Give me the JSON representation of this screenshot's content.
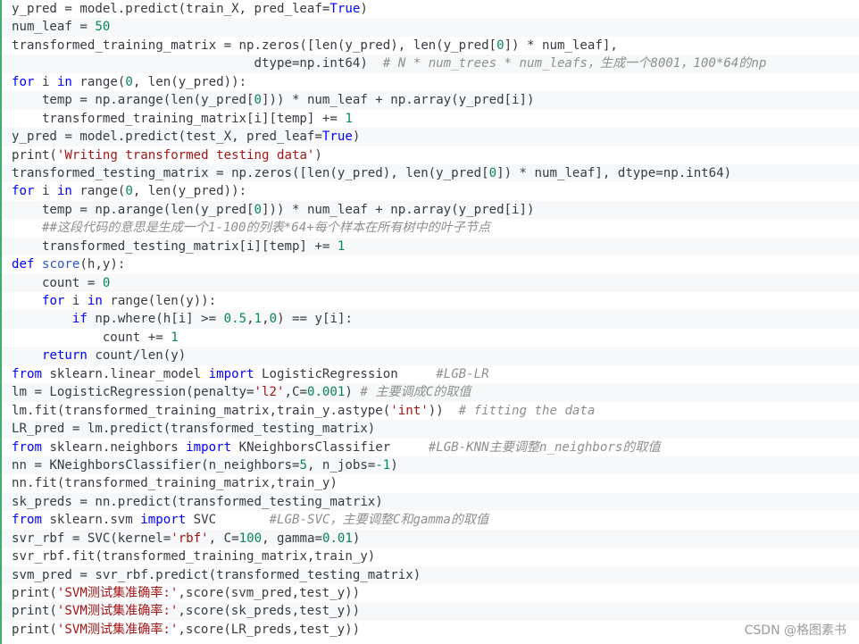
{
  "code": {
    "language": "python",
    "lines": [
      [
        {
          "t": "y_pred = model.predict(train_X, pred_leaf=",
          "c": "p"
        },
        {
          "t": "True",
          "c": "kw"
        },
        {
          "t": ")",
          "c": "p"
        }
      ],
      [
        {
          "t": "num_leaf = ",
          "c": "p"
        },
        {
          "t": "50",
          "c": "num"
        }
      ],
      [
        {
          "t": "transformed_training_matrix = np.zeros([len(y_pred), len(y_pred[",
          "c": "p"
        },
        {
          "t": "0",
          "c": "num"
        },
        {
          "t": "]) * num_leaf],",
          "c": "p"
        }
      ],
      [
        {
          "t": "                                dtype=np.int64)  ",
          "c": "p"
        },
        {
          "t": "# N * num_trees * num_leafs，生成一个8001，100*64的np",
          "c": "cm"
        }
      ],
      [
        {
          "t": "for",
          "c": "kw"
        },
        {
          "t": " i ",
          "c": "p"
        },
        {
          "t": "in",
          "c": "kw"
        },
        {
          "t": " range(",
          "c": "p"
        },
        {
          "t": "0",
          "c": "num"
        },
        {
          "t": ", len(y_pred)):",
          "c": "p"
        }
      ],
      [
        {
          "t": "    temp = np.arange(len(y_pred[",
          "c": "p"
        },
        {
          "t": "0",
          "c": "num"
        },
        {
          "t": "])) * num_leaf + np.array(y_pred[i])",
          "c": "p"
        }
      ],
      [
        {
          "t": "    transformed_training_matrix[i][temp] += ",
          "c": "p"
        },
        {
          "t": "1",
          "c": "num"
        }
      ],
      [
        {
          "t": "y_pred = model.predict(test_X, pred_leaf=",
          "c": "p"
        },
        {
          "t": "True",
          "c": "kw"
        },
        {
          "t": ")",
          "c": "p"
        }
      ],
      [
        {
          "t": "print(",
          "c": "p"
        },
        {
          "t": "'Writing transformed testing data'",
          "c": "str"
        },
        {
          "t": ")",
          "c": "p"
        }
      ],
      [
        {
          "t": "transformed_testing_matrix = np.zeros([len(y_pred), len(y_pred[",
          "c": "p"
        },
        {
          "t": "0",
          "c": "num"
        },
        {
          "t": "]) * num_leaf], dtype=np.int64)",
          "c": "p"
        }
      ],
      [
        {
          "t": "for",
          "c": "kw"
        },
        {
          "t": " i ",
          "c": "p"
        },
        {
          "t": "in",
          "c": "kw"
        },
        {
          "t": " range(",
          "c": "p"
        },
        {
          "t": "0",
          "c": "num"
        },
        {
          "t": ", len(y_pred)):",
          "c": "p"
        }
      ],
      [
        {
          "t": "    temp = np.arange(len(y_pred[",
          "c": "p"
        },
        {
          "t": "0",
          "c": "num"
        },
        {
          "t": "])) * num_leaf + np.array(y_pred[i])",
          "c": "p"
        }
      ],
      [
        {
          "t": "    ",
          "c": "p"
        },
        {
          "t": "##这段代码的意思是生成一个1-100的列表*64+每个样本在所有树中的叶子节点",
          "c": "cm"
        }
      ],
      [
        {
          "t": "    transformed_testing_matrix[i][temp] += ",
          "c": "p"
        },
        {
          "t": "1",
          "c": "num"
        }
      ],
      [
        {
          "t": "def",
          "c": "kw"
        },
        {
          "t": " ",
          "c": "p"
        },
        {
          "t": "score",
          "c": "fn"
        },
        {
          "t": "(h,y):",
          "c": "p"
        }
      ],
      [
        {
          "t": "    count = ",
          "c": "p"
        },
        {
          "t": "0",
          "c": "num"
        }
      ],
      [
        {
          "t": "    ",
          "c": "p"
        },
        {
          "t": "for",
          "c": "kw"
        },
        {
          "t": " i ",
          "c": "p"
        },
        {
          "t": "in",
          "c": "kw"
        },
        {
          "t": " range(len(y)):",
          "c": "p"
        }
      ],
      [
        {
          "t": "        ",
          "c": "p"
        },
        {
          "t": "if",
          "c": "kw"
        },
        {
          "t": " np.where(h[i] >= ",
          "c": "p"
        },
        {
          "t": "0.5",
          "c": "num"
        },
        {
          "t": ",",
          "c": "p"
        },
        {
          "t": "1",
          "c": "num"
        },
        {
          "t": ",",
          "c": "p"
        },
        {
          "t": "0",
          "c": "num"
        },
        {
          "t": ") == y[i]:",
          "c": "p"
        }
      ],
      [
        {
          "t": "            count += ",
          "c": "p"
        },
        {
          "t": "1",
          "c": "num"
        }
      ],
      [
        {
          "t": "    ",
          "c": "p"
        },
        {
          "t": "return",
          "c": "kw"
        },
        {
          "t": " count/len(y)",
          "c": "p"
        }
      ],
      [
        {
          "t": "from",
          "c": "kw"
        },
        {
          "t": " sklearn.linear_model ",
          "c": "p"
        },
        {
          "t": "import",
          "c": "kw"
        },
        {
          "t": " LogisticRegression     ",
          "c": "p"
        },
        {
          "t": "#LGB-LR",
          "c": "cm"
        }
      ],
      [
        {
          "t": "lm = LogisticRegression(penalty=",
          "c": "p"
        },
        {
          "t": "'l2'",
          "c": "str"
        },
        {
          "t": ",C=",
          "c": "p"
        },
        {
          "t": "0.001",
          "c": "num"
        },
        {
          "t": ") ",
          "c": "p"
        },
        {
          "t": "# 主要调成C的取值",
          "c": "cm"
        }
      ],
      [
        {
          "t": "lm.fit(transformed_training_matrix,train_y.astype(",
          "c": "p"
        },
        {
          "t": "'int'",
          "c": "str"
        },
        {
          "t": "))  ",
          "c": "p"
        },
        {
          "t": "# fitting the data",
          "c": "cm"
        }
      ],
      [
        {
          "t": "LR_pred = lm.predict(transformed_testing_matrix)",
          "c": "p"
        }
      ],
      [
        {
          "t": "from",
          "c": "kw"
        },
        {
          "t": " sklearn.neighbors ",
          "c": "p"
        },
        {
          "t": "import",
          "c": "kw"
        },
        {
          "t": " KNeighborsClassifier     ",
          "c": "p"
        },
        {
          "t": "#LGB-KNN主要调整n_neighbors的取值",
          "c": "cm"
        }
      ],
      [
        {
          "t": "nn = KNeighborsClassifier(n_neighbors=",
          "c": "p"
        },
        {
          "t": "5",
          "c": "num"
        },
        {
          "t": ", n_jobs=",
          "c": "p"
        },
        {
          "t": "-1",
          "c": "num"
        },
        {
          "t": ")",
          "c": "p"
        }
      ],
      [
        {
          "t": "nn.fit(transformed_training_matrix,train_y)",
          "c": "p"
        }
      ],
      [
        {
          "t": "sk_preds = nn.predict(transformed_testing_matrix)",
          "c": "p"
        }
      ],
      [
        {
          "t": "from",
          "c": "kw"
        },
        {
          "t": " sklearn.svm ",
          "c": "p"
        },
        {
          "t": "import",
          "c": "kw"
        },
        {
          "t": " SVC       ",
          "c": "p"
        },
        {
          "t": "#LGB-SVC，主要调整C和gamma的取值",
          "c": "cm"
        }
      ],
      [
        {
          "t": "svr_rbf = SVC(kernel=",
          "c": "p"
        },
        {
          "t": "'rbf'",
          "c": "str"
        },
        {
          "t": ", C=",
          "c": "p"
        },
        {
          "t": "100",
          "c": "num"
        },
        {
          "t": ", gamma=",
          "c": "p"
        },
        {
          "t": "0.01",
          "c": "num"
        },
        {
          "t": ")",
          "c": "p"
        }
      ],
      [
        {
          "t": "svr_rbf.fit(transformed_training_matrix,train_y)",
          "c": "p"
        }
      ],
      [
        {
          "t": "svm_pred = svr_rbf.predict(transformed_testing_matrix)",
          "c": "p"
        }
      ],
      [
        {
          "t": "print(",
          "c": "p"
        },
        {
          "t": "'SVM测试集准确率:'",
          "c": "str"
        },
        {
          "t": ",score(svm_pred,test_y))",
          "c": "p"
        }
      ],
      [
        {
          "t": "print(",
          "c": "p"
        },
        {
          "t": "'SVM测试集准确率:'",
          "c": "str"
        },
        {
          "t": ",score(sk_preds,test_y))",
          "c": "p"
        }
      ],
      [
        {
          "t": "print(",
          "c": "p"
        },
        {
          "t": "'SVM测试集准确率:'",
          "c": "str"
        },
        {
          "t": ",score(LR_preds,test_y))",
          "c": "p"
        }
      ]
    ]
  },
  "watermark": "CSDN @格图素书",
  "colors": {
    "keyword": "#0000ff",
    "number": "#098658",
    "string": "#a31515",
    "comment": "#8e908c",
    "function": "#2b56c5",
    "plain": "#383a42",
    "accent_border": "#3db16b"
  }
}
